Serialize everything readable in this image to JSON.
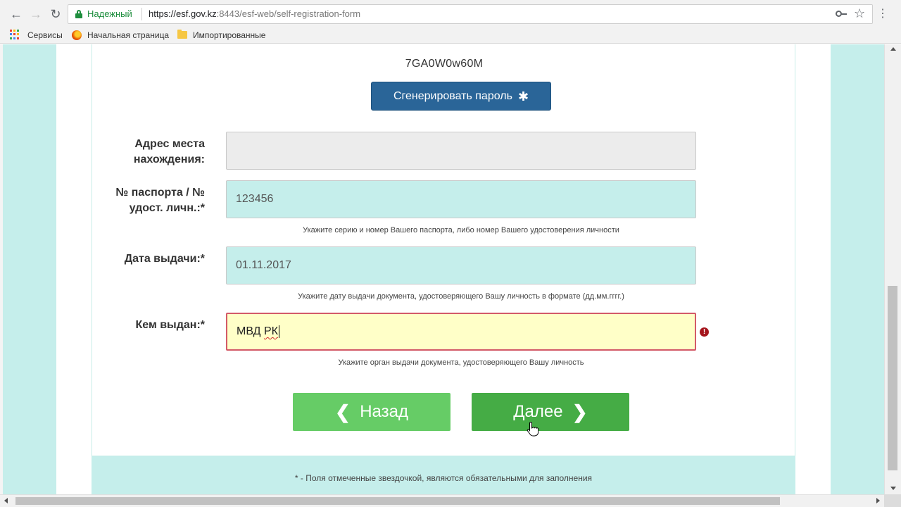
{
  "browser": {
    "secure_label": "Надежный",
    "url_main": "https://esf.gov.kz",
    "url_rest": ":8443/esf-web/self-registration-form",
    "bookmarks": {
      "apps": "Сервисы",
      "home": "Начальная страница",
      "imported": "Импортированные"
    }
  },
  "form": {
    "generated_password": "7GA0W0w60M",
    "generate_button_label": "Сгенерировать пароль",
    "address": {
      "label_line1": "Адрес места",
      "label_line2": "нахождения:",
      "value": ""
    },
    "passport": {
      "label_line1": "№ паспорта / №",
      "label_line2": "удост. личн.:*",
      "value": "123456",
      "hint": "Укажите серию и номер Вашего паспорта, либо номер Вашего удостоверения личности"
    },
    "issue_date": {
      "label": "Дата выдачи:*",
      "value": "01.11.2017",
      "hint": "Укажите дату выдачи документа, удостоверяющего Вашу личность в формате (дд.мм.гггг.)"
    },
    "issued_by": {
      "label": "Кем выдан:*",
      "value_part1": "МВД ",
      "value_part2": "РК",
      "hint": "Укажите орган выдачи документа, удостоверяющего Вашу личность",
      "error_mark": "!"
    },
    "back_button_label": "Назад",
    "next_button_label": "Далее",
    "required_note": "* - Поля отмеченные звездочкой, являются обязательными для заполнения"
  },
  "icons": {
    "back_chevron": "❮",
    "next_chevron": "❯",
    "gear": "✱",
    "star": "☆",
    "menu": "⋮",
    "nav_back": "←",
    "nav_forward": "→",
    "reload": "↻"
  },
  "colors": {
    "field_filled": "#c5eeeb",
    "field_error_bg": "#ffffc8",
    "field_error_border": "#d35a68",
    "generate_button": "#2a6598",
    "back_button": "#66cc66",
    "next_button": "#45ac45",
    "secure_green": "#1e8e3e"
  }
}
